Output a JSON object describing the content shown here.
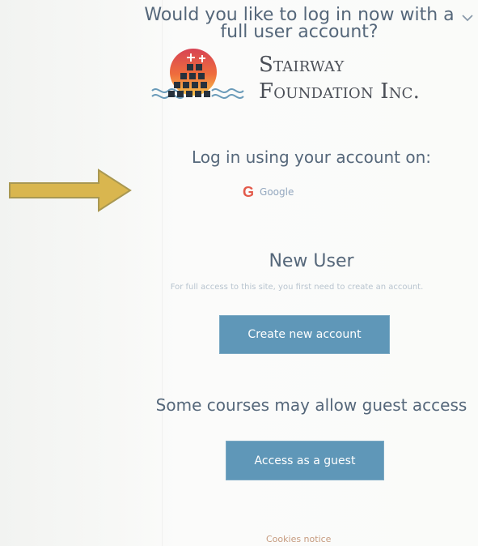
{
  "login_prompt": {
    "title": "Would you like to log in now with a full user account?"
  },
  "brand": {
    "line_1": "Stairway",
    "line_2": "Foundation Inc.",
    "logo_icon": "stairway-sun-logo-icon"
  },
  "external_login": {
    "title": "Log in using your account on:",
    "provider_label": "Google",
    "provider_icon": "google-g-icon",
    "arrow_icon": "arrow-right-icon"
  },
  "new_user": {
    "title": "New User",
    "description": "For full access to this site, you first need to create an account.",
    "button_label": "Create new account"
  },
  "guest": {
    "title": "Some courses may allow guest access",
    "button_label": "Access as a guest"
  },
  "footer": {
    "cookies_notice": "Cookies notice"
  },
  "colors": {
    "heading": "#55677a",
    "button": "#5f97b8",
    "arrow": "#d9b64f",
    "google_red": "#e35a4b",
    "cookies_link": "#c69b7f"
  }
}
